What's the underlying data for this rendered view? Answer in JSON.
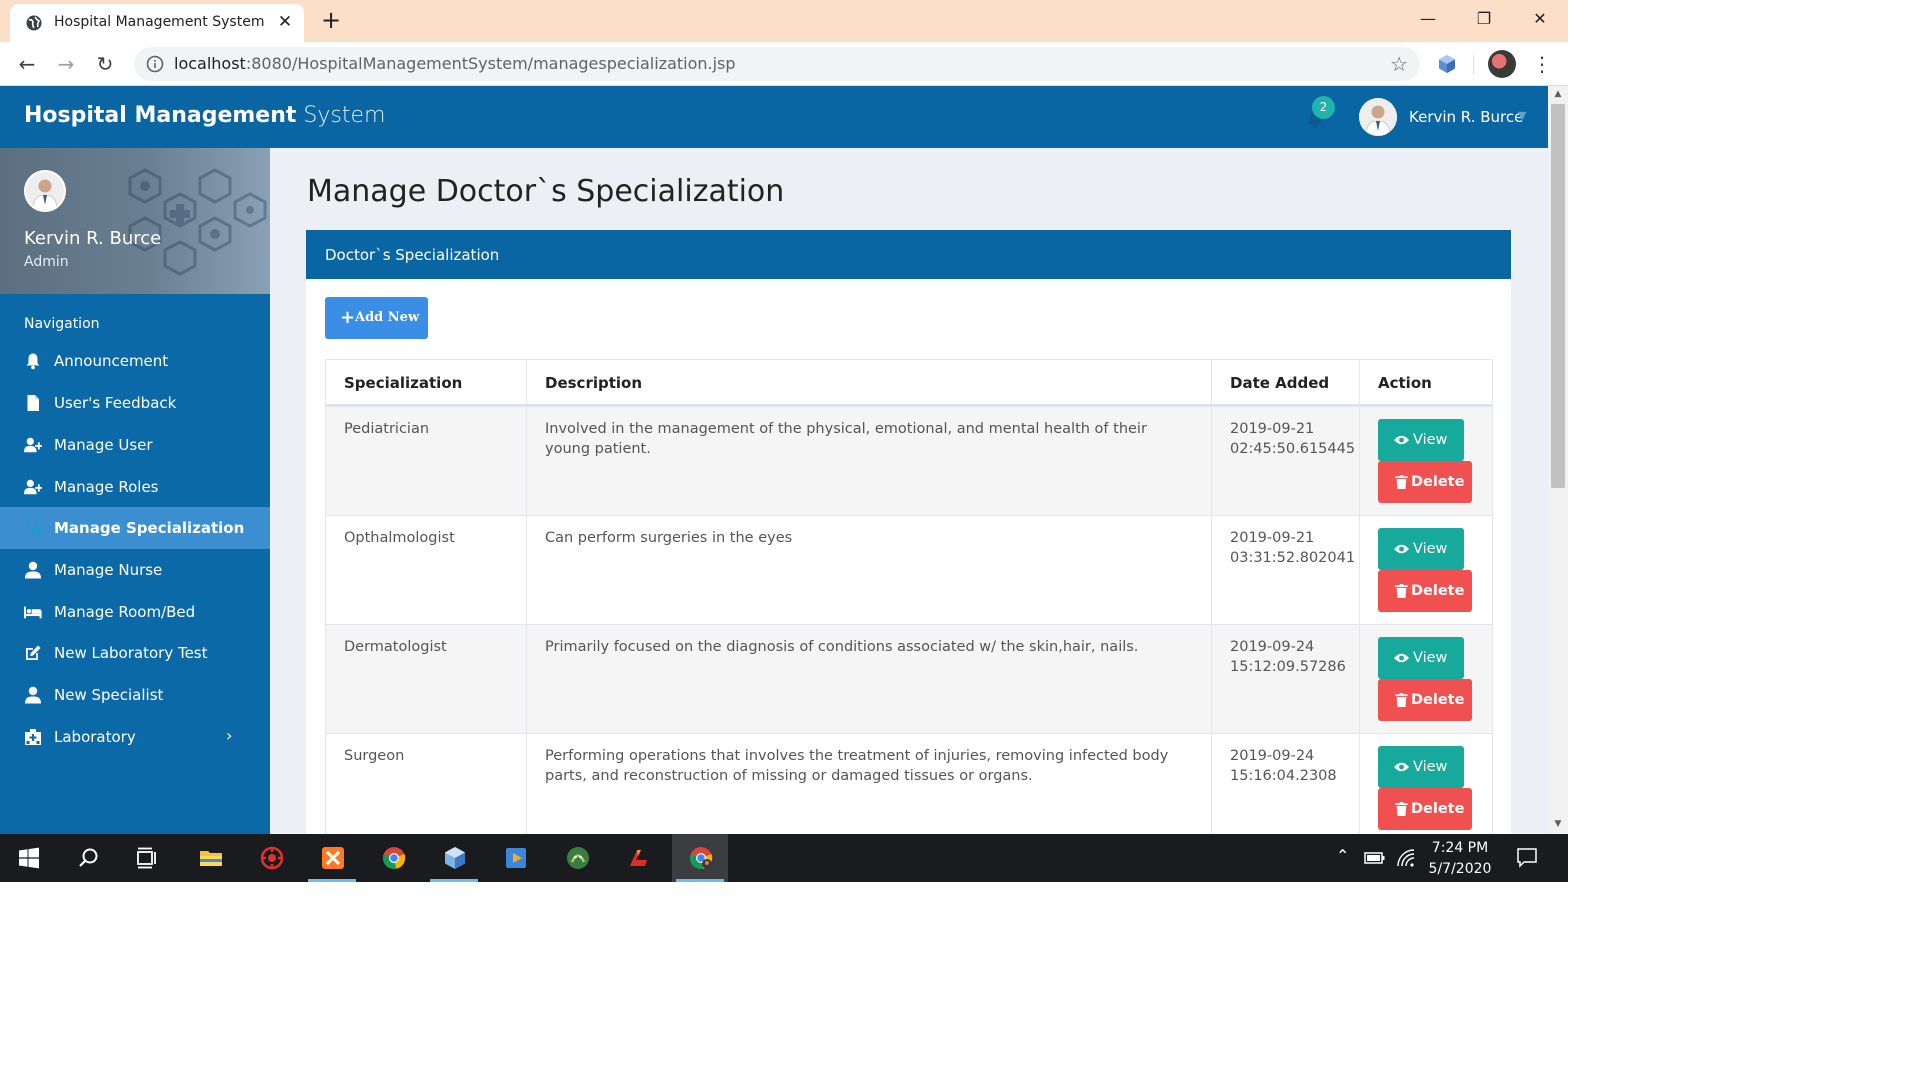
{
  "browser": {
    "tab_title": "Hospital Management System",
    "new_tab_symbol": "+",
    "url_host": "localhost",
    "url_rest": ":8080/HospitalManagementSystem/managespecialization.jsp"
  },
  "header": {
    "brand_bold": "Hospital Management",
    "brand_light": " System",
    "notification_count": "2",
    "user_name": "Kervin R. Burce"
  },
  "sidebar": {
    "profile_name": "Kervin R. Burce",
    "profile_role": "Admin",
    "nav_heading": "Navigation",
    "items": [
      {
        "label": "Announcement",
        "icon": "bell-icon"
      },
      {
        "label": "User's Feedback",
        "icon": "file-icon"
      },
      {
        "label": "Manage User",
        "icon": "user-plus-icon"
      },
      {
        "label": "Manage Roles",
        "icon": "user-plus-icon"
      },
      {
        "label": "Manage Specialization",
        "icon": "stethoscope-icon",
        "active": true
      },
      {
        "label": "Manage Nurse",
        "icon": "user-icon"
      },
      {
        "label": "Manage Room/Bed",
        "icon": "bed-icon"
      },
      {
        "label": "New Laboratory Test",
        "icon": "edit-icon"
      },
      {
        "label": "New Specialist",
        "icon": "user-icon"
      },
      {
        "label": "Laboratory",
        "icon": "hospital-icon",
        "has_submenu": true
      }
    ]
  },
  "main": {
    "page_title": "Manage Doctor`s Specialization",
    "panel_title": "Doctor`s Specialization",
    "add_button": "Add New",
    "columns": [
      "Specialization",
      "Description",
      "Date Added",
      "Action"
    ],
    "rows": [
      {
        "specialization": "Pediatrician",
        "description": "Involved in the management of the physical, emotional, and mental health of their young patient.",
        "date_line1": "2019-09-21",
        "date_line2": "02:45:50.615445"
      },
      {
        "specialization": "Opthalmologist",
        "description": "Can perform surgeries in the eyes",
        "date_line1": "2019-09-21",
        "date_line2": "03:31:52.802041"
      },
      {
        "specialization": "Dermatologist",
        "description": "Primarily focused on the diagnosis of conditions associated w/ the skin,hair, nails.",
        "date_line1": "2019-09-24",
        "date_line2": "15:12:09.57286"
      },
      {
        "specialization": "Surgeon",
        "description": "Performing operations that involves the treatment of injuries, removing infected body parts, and reconstruction of missing or damaged tissues or organs.",
        "date_line1": "2019-09-24",
        "date_line2": "15:16:04.2308"
      }
    ],
    "view_label": "View",
    "delete_label": "Delete"
  },
  "taskbar": {
    "time": "7:24 PM",
    "date": "5/7/2020"
  },
  "colors": {
    "brand_blue": "#0a65a3",
    "active_nav": "#3b8fd0",
    "view_button": "#16a99c",
    "delete_button": "#f05050",
    "add_button": "#3a8ee6",
    "badge": "#1fb5ad"
  }
}
